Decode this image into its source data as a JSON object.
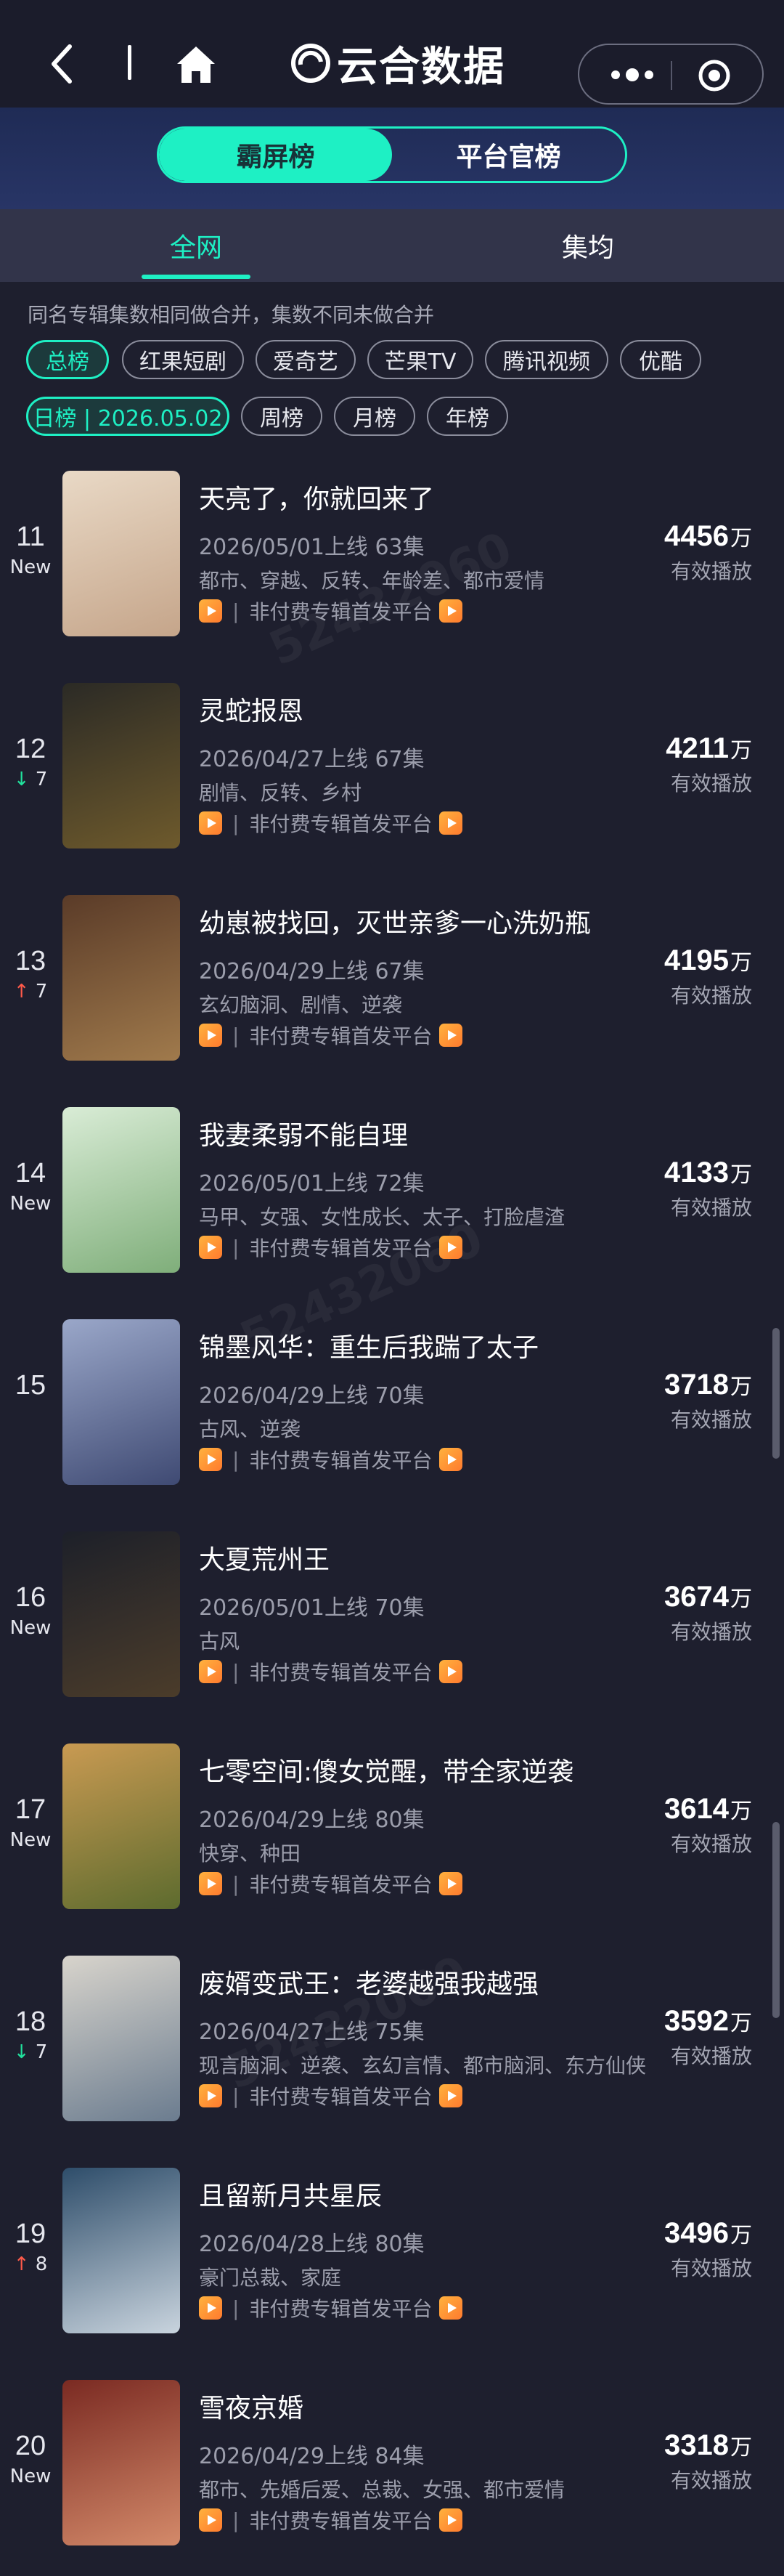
{
  "header": {
    "brand": "云合数据",
    "icons": [
      "back-icon",
      "home-icon",
      "more-dots-icon",
      "target-icon"
    ]
  },
  "segment": {
    "tabs": [
      {
        "label": "霸屏榜",
        "active": true
      },
      {
        "label": "平台官榜",
        "active": false
      }
    ]
  },
  "subtabs": [
    {
      "label": "全网",
      "active": true
    },
    {
      "label": "集均",
      "active": false
    }
  ],
  "filters": {
    "note": "同名专辑集数相同做合并，集数不同未做合并",
    "platforms": [
      {
        "label": "总榜",
        "active": true
      },
      {
        "label": "红果短剧",
        "active": false
      },
      {
        "label": "爱奇艺",
        "active": false
      },
      {
        "label": "芒果TV",
        "active": false
      },
      {
        "label": "腾讯视频",
        "active": false
      },
      {
        "label": "优酷",
        "active": false
      }
    ],
    "periods": [
      {
        "label": "日榜 | 2026.05.02",
        "active": true
      },
      {
        "label": "周榜",
        "active": false
      },
      {
        "label": "月榜",
        "active": false
      },
      {
        "label": "年榜",
        "active": false
      }
    ]
  },
  "labels": {
    "platform_text": "非付费专辑首发平台",
    "separator": "|",
    "plays_label": "有效播放",
    "unit": "万"
  },
  "items": [
    {
      "rank": "11",
      "trend": "New",
      "trend_type": "new",
      "title": "天亮了，你就回来了",
      "meta": "2026/05/01上线 63集",
      "tags": "都市、穿越、反转、年龄差、都市爱情",
      "plays": "4456",
      "poster": [
        "#e9d9c6",
        "#c5a58a"
      ]
    },
    {
      "rank": "12",
      "trend": "7",
      "trend_type": "down",
      "title": "灵蛇报恩",
      "meta": "2026/04/27上线 67集",
      "tags": "剧情、反转、乡村",
      "plays": "4211",
      "poster": [
        "#2b2a25",
        "#6e5a2c"
      ]
    },
    {
      "rank": "13",
      "trend": "7",
      "trend_type": "up",
      "title": "幼崽被找回，灭世亲爹一心洗奶瓶",
      "meta": "2026/04/29上线 67集",
      "tags": "玄幻脑洞、剧情、逆袭",
      "plays": "4195",
      "poster": [
        "#5a3b28",
        "#a07a4c"
      ]
    },
    {
      "rank": "14",
      "trend": "New",
      "trend_type": "new",
      "title": "我妻柔弱不能自理",
      "meta": "2026/05/01上线 72集",
      "tags": "马甲、女强、女性成长、太子、打脸虐渣",
      "plays": "4133",
      "poster": [
        "#d9ecd6",
        "#7fae7a"
      ]
    },
    {
      "rank": "15",
      "trend": "",
      "trend_type": "none",
      "title": "锦墨风华：重生后我踹了太子",
      "meta": "2026/04/29上线 70集",
      "tags": "古风、逆袭",
      "plays": "3718",
      "poster": [
        "#9aa7c9",
        "#3f4a73"
      ]
    },
    {
      "rank": "16",
      "trend": "New",
      "trend_type": "new",
      "title": "大夏荒州王",
      "meta": "2026/05/01上线 70集",
      "tags": "古风",
      "plays": "3674",
      "poster": [
        "#1d2029",
        "#4b3c2a"
      ]
    },
    {
      "rank": "17",
      "trend": "New",
      "trend_type": "new",
      "title": "七零空间:傻女觉醒，带全家逆袭",
      "meta": "2026/04/29上线 80集",
      "tags": "快穿、种田",
      "plays": "3614",
      "poster": [
        "#c99a52",
        "#5d6b2e"
      ]
    },
    {
      "rank": "18",
      "trend": "7",
      "trend_type": "down",
      "title": "废婿变武王：老婆越强我越强",
      "meta": "2026/04/27上线 75集",
      "tags": "现言脑洞、逆袭、玄幻言情、都市脑洞、东方仙侠",
      "plays": "3592",
      "poster": [
        "#d8d4cc",
        "#6b7c8f"
      ]
    },
    {
      "rank": "19",
      "trend": "8",
      "trend_type": "up",
      "title": "且留新月共星辰",
      "meta": "2026/04/28上线 80集",
      "tags": "豪门总裁、家庭",
      "plays": "3496",
      "poster": [
        "#2e4d6a",
        "#c9d4de"
      ]
    },
    {
      "rank": "20",
      "trend": "New",
      "trend_type": "new",
      "title": "雪夜京婚",
      "meta": "2026/04/29上线 84集",
      "tags": "都市、先婚后爱、总裁、女强、都市爱情",
      "plays": "3318",
      "poster": [
        "#7a2a22",
        "#d48a6a"
      ]
    }
  ]
}
